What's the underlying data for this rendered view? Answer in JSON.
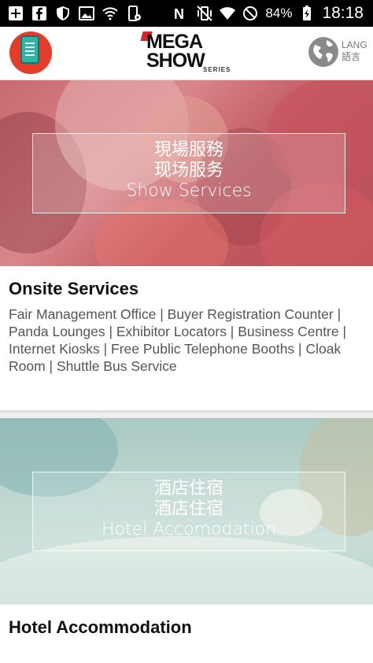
{
  "status_bar": {
    "battery": "84%",
    "time": "18:18"
  },
  "app_bar": {
    "logo": {
      "line1": "MEGA",
      "line2": "SHOW",
      "line3": "SERIES"
    },
    "lang": {
      "line1": "LANG",
      "line2": "語言"
    }
  },
  "sections": [
    {
      "banner": {
        "line1": "現場服務",
        "line2": "现场服务",
        "line3": "Show Services"
      },
      "title": "Onsite Services",
      "description": "Fair Management Office | Buyer Registration Counter | Panda Lounges | Exhibitor Locators | Business Centre | Internet Kiosks | Free Public Telephone Booths | Cloak Room | Shuttle Bus Service"
    },
    {
      "banner": {
        "line1": "酒店住宿",
        "line2": "酒店住宿",
        "line3": "Hotel Accomodation"
      },
      "title": "Hotel Accommodation"
    }
  ],
  "colors": {
    "accent_red": "#e53b2b",
    "tablet_teal": "#2fb5a6",
    "banner1_tint": "#c86a70",
    "banner2_tint": "#a9c9c2"
  }
}
